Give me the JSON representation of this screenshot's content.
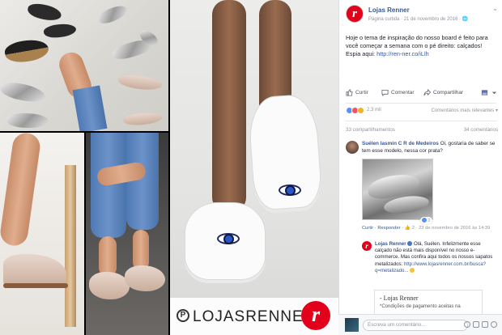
{
  "watermark": {
    "brand_text": "LOJASRENNER",
    "logo_letter": "r",
    "pin_letter": "P"
  },
  "post": {
    "page_name": "Lojas Renner",
    "avatar_letter": "r",
    "meta": "Página curtida · 21 de novembro de 2016 · 🌐",
    "menu": "⌄",
    "text": "Hoje o tema de inspiração do nosso board é feito para você começar a semana com o pé direito: calçados! Espia aqui: ",
    "link": "http://ren-ner.co/iLlh",
    "actions": {
      "like": "Curtir",
      "comment": "Comentar",
      "share": "Compartilhar"
    },
    "reactions_count": "2,3 mil",
    "sort_label": "Comentários mais relevantes ▾",
    "shares": "33 compartilhamentos",
    "comments_count": "34 comentários"
  },
  "comment": {
    "author": "Suélen Iasmin C R de Medeiros",
    "text": " Oi, gostaria de saber se tem esse modelo, nessa cor prata?",
    "reaction_count": "2",
    "reply_link": "Curtir · Responder · ",
    "meta": "2 · 23 de novembro de 2016 às 14:39",
    "meta_icon": "👍"
  },
  "reply": {
    "author": "Lojas Renner",
    "avatar_letter": "r",
    "text": " Olá, Suélen. Infelizmente esse calçado não está mais disponível no nosso e-commerce. Mas confira aqui todos os nossos sapatos metalizados: ",
    "link": "http://www.lojasrenner.com.br/busca?q=metalizado..."
  },
  "preview": {
    "title": "- Lojas Renner",
    "subtitle": "*Condições de pagamento aceitas na"
  },
  "composer": {
    "placeholder": "Escreva um comentário..."
  }
}
